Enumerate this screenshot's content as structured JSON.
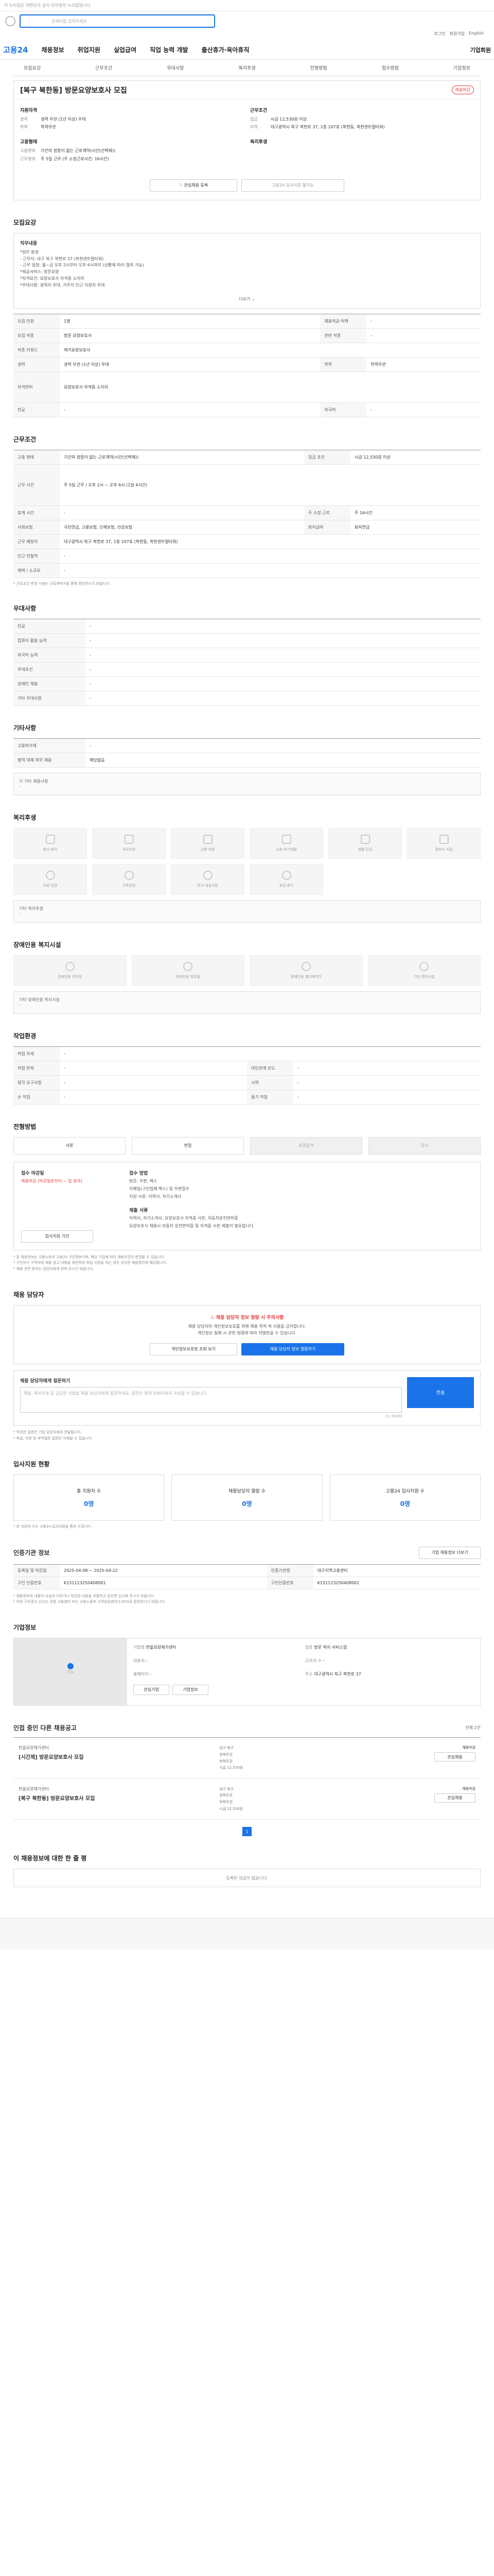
{
  "topbar": {
    "notice": "이 누리집은 대한민국 공식 전자정부 누리집입니다."
  },
  "search": {
    "placeholder": "검색어를 입력하세요"
  },
  "util": [
    "로그인",
    "회원가입",
    "English"
  ],
  "gnb": {
    "brand": "고용24",
    "items": [
      "채용정보",
      "취업지원",
      "실업급여",
      "직업 능력 개발",
      "출산휴가·육아휴직"
    ],
    "right": "기업회원"
  },
  "subtabs": [
    "모집요강",
    "근무조건",
    "우대사항",
    "복리후생",
    "전형방법",
    "접수방법",
    "기업정보"
  ],
  "job": {
    "title": "[복구 북한동] 방문요양보호사 모집",
    "status": "채용마감",
    "left_heading": "지원자격",
    "left": [
      {
        "k": "경력",
        "v": "경력 무관 (1년 이상) 우대"
      },
      {
        "k": "학력",
        "v": "학력무관"
      }
    ],
    "left2_heading": "고용형태",
    "left2": [
      {
        "k": "고용형태",
        "v": "기간의 정함이 없는 근로계약(시간(선택제))"
      },
      {
        "k": "근무형태",
        "v": "주 5일 근무 (주 소정근로시간: 16시간)"
      }
    ],
    "right_heading": "근무조건",
    "right": [
      {
        "k": "임금",
        "v": "시급 12,530원 이상"
      },
      {
        "k": "지역",
        "v": "대구광역시 북구 복현로 37, 1층 107호 (복현동, 복현센트럴타워)"
      }
    ],
    "right2_heading": "복리후생",
    "buttons": [
      "관심채용 등록",
      "고용24 입사지원 불가능"
    ]
  },
  "summary": {
    "heading": "모집요강",
    "label": "직무내용",
    "lines": [
      "*업무 환경",
      "- 근무지: 대구 북구 복현로 37 (복현센트럴타워)",
      "- 근무 일정: 월~금 오후 2시부터 오후 6시까지 (상황에 따라 협의 가능)",
      "*제공서비스: 방문요양",
      "*자격요건: 요양보호사 자격증 소지자",
      "*우대사항: 경력자 우대, 거주지 인근 지원자 우대"
    ],
    "more": "더보기"
  },
  "recruit_rows": [
    {
      "k1": "모집 인원",
      "v1": "1명",
      "k2": "채용직급·직책",
      "v2": "-"
    },
    {
      "k1": "모집 직종",
      "v1": "방문 요양보호사",
      "k2": "관련 직종",
      "v2": "-"
    },
    {
      "k1": "직종 키워드",
      "v1": "재가요양보호사",
      "k2": "",
      "v2": ""
    },
    {
      "k1": "경력",
      "v1": "경력 무관 (1년 이상) 우대",
      "k2": "학력",
      "v2": "학력무관"
    },
    {
      "k1": "자격면허",
      "v1": "요양보호사 자격증 소지자",
      "k2": "",
      "v2": ""
    },
    {
      "k1": "전공",
      "v1": "-",
      "k2": "외국어",
      "v2": "-"
    }
  ],
  "work": {
    "heading": "근무조건",
    "rows": [
      {
        "k1": "고용 형태",
        "v1": "기간의 정함이 없는 근로계약(시간(선택제))",
        "k2": "임금 조건",
        "v2": "시급 12,530원 이상"
      },
      {
        "k1": "근무 시간",
        "v1": "주 5일 근무 / 오후 2시 ~ 오후 6시 (1일 4시간)",
        "k2": "",
        "v2": ""
      },
      {
        "k1": "휴게 시간",
        "v1": "-",
        "k2": "주 소정 근로",
        "v2": "주 16시간"
      },
      {
        "k1": "사회보험",
        "v1": "국민연금, 고용보험, 산재보험, 건강보험",
        "k2": "퇴직급여",
        "v2": "퇴직연금"
      },
      {
        "k1": "근무 예정지",
        "v1": "대구광역시 북구 복현로 37, 1층 107호 (복현동, 복현센트럴타워)",
        "k2": "",
        "v2": ""
      },
      {
        "k1": "인근 전철역",
        "v1": "-",
        "k2": "",
        "v2": ""
      },
      {
        "k1": "재택 / 소규모",
        "v1": "-",
        "k2": "",
        "v2": ""
      }
    ],
    "note": "* 근로조건 변경 시에는 근로계약서를 통해 확인하시기 바랍니다."
  },
  "prefer": {
    "heading": "우대사항",
    "rows": [
      {
        "k": "전공",
        "v": "-"
      },
      {
        "k": "컴퓨터 활용 능력",
        "v": "-"
      },
      {
        "k": "외국어 능력",
        "v": "-"
      },
      {
        "k": "우대조건",
        "v": "-"
      },
      {
        "k": "장애인 채용",
        "v": "-"
      },
      {
        "k": "기타 우대사항",
        "v": "-"
      }
    ]
  },
  "etc": {
    "heading": "기타사항",
    "rows": [
      {
        "k": "고용허가제",
        "v": "-"
      },
      {
        "k": "병역 대체 복무 채용",
        "v": "해당없음"
      }
    ],
    "extra_label": "기 기타 채용사항",
    "extra_value": "-"
  },
  "welfare": {
    "heading": "복리후생",
    "items": [
      "휴가·휴직",
      "식사지원",
      "교통·차량",
      "교육·자기계발",
      "생활·건강",
      "경조사 지원",
      "의료·건강",
      "가족친화",
      "주거·대출지원",
      "포상·휴가"
    ],
    "etc_label": "기타 복리후생",
    "etc_value": "-"
  },
  "disabled": {
    "heading": "장애인용 복지시설",
    "items": [
      "장애인용 주차장",
      "장애인용 화장실",
      "장애인용 엘리베이터",
      "기타 편의시설"
    ],
    "etc_label": "기타 장애인용 복지시설",
    "etc_value": "-"
  },
  "env": {
    "heading": "작업환경",
    "rows": [
      {
        "k1": "작업 자세",
        "v1": "-",
        "k2": "",
        "v2": ""
      },
      {
        "k1": "작업 반복",
        "v1": "-",
        "k2": "대인관계 빈도",
        "v2": "-"
      },
      {
        "k1": "청각 요구사항",
        "v1": "-",
        "k2": "시력",
        "v2": "-"
      },
      {
        "k1": "손 작업",
        "v1": "-",
        "k2": "들기 작업",
        "v2": "-"
      }
    ]
  },
  "process": {
    "heading": "전형방법",
    "steps": [
      "서류",
      "면접",
      "최종합격",
      "입사"
    ],
    "apply_heading": "접수 마감일",
    "apply_date": "채용마감 (마감일로부터 ~ 일 경과)",
    "method_heading": "접수 방법",
    "method_lines": [
      "방문, 우편, 팩스",
      "이메일(구인업체 팩스) 및 우편접수",
      "지원 서류: 이력서, 자기소개서"
    ],
    "docs_heading": "제출 서류",
    "docs_lines": [
      "이력서, 자기소개서, 요양보호사 자격증 사본, 자동차운전면허증",
      "요양보호사 채용시 자동차 운전면허증 및 자격증 사본 제출이 필요합니다."
    ],
    "apply_button": "입사지원 기간",
    "notices": [
      "* 본 채용정보는 고용노동부 고용24 구인정보이며, 해당 기업에 따라 채용조건이 변경될 수 있습니다.",
      "* 구인자가 구직자의 채용 광고 내용을 위반하여 취업 지원을 하는 경우 부당한 채용절차에 해당됩니다.",
      "* 채용 관련 문의는 담당자에게 연락 주시기 바랍니다."
    ]
  },
  "contact": {
    "heading": "채용 담당자",
    "warn": "채용 담당자 정보 열람 시 주의사항",
    "lines": [
      "채용 담당자의 개인정보보호를 위해 채용 목적 외 사용을 금지합니다.",
      "개인정보 침해 시 관련 법령에 따라 처벌받을 수 있습니다."
    ],
    "buttons": [
      "개인정보보호법 조회 보기",
      "채용 담당자 정보 열람하기"
    ]
  },
  "question": {
    "label": "채용 담당자에게 질문하기",
    "placeholder": "채용, 복리후생 등 궁금한 사항을 채용 담당자에게 질문하세요. 질문은 최대 500자까지 작성할 수 있습니다.",
    "counter": "0 / 500자",
    "send": "전송",
    "notes": [
      "* 작성한 질문은 기업 담당자에게 전달됩니다.",
      "* 욕설, 비방 등 부적절한 질문은 삭제될 수 있습니다."
    ]
  },
  "status": {
    "heading": "입사지원 현황",
    "items": [
      {
        "label": "총 지원자 수",
        "value": "0명"
      },
      {
        "label": "채용담당자 열람 수",
        "value": "0명"
      },
      {
        "label": "고용24 입사지원 수",
        "value": "0명"
      }
    ],
    "note": "* 본 지원자 수는 고용24 입사지원을 통한 수입니다."
  },
  "company": {
    "heading": "인증기관 정보",
    "button": "기업 채용정보 더보기",
    "rows": [
      {
        "k1": "등록일 및 마감일",
        "v1": "2025-04-08 ~ 2025-04-22",
        "k2": "인증기관명",
        "v2": "대구지역고용센터"
      },
      {
        "k1": "구인 인증번호",
        "v1": "K151123250408001",
        "k2": "구인인증번호",
        "v2": "K151123250408001"
      }
    ],
    "notes": [
      "* 채용정보의 내용이 사실과 다르거나 부당한 내용을 포함하고 있으면 신고해 주시기 바랍니다.",
      "* 허위 구인광고 신고는 관할 고용센터 또는 고용노동부 고객상담센터(1350)로 문의하시기 바랍니다."
    ]
  },
  "corp": {
    "heading": "기업정보",
    "map_label": "지도",
    "rows": [
      {
        "k": "기업명",
        "v": "한울요양재가센터"
      },
      {
        "k": "업종",
        "v": "방문 복지 서비스업"
      },
      {
        "k": "대표자",
        "v": "-"
      },
      {
        "k": "근로자 수",
        "v": "-"
      },
      {
        "k": "홈페이지",
        "v": "-"
      },
      {
        "k": "주소",
        "v": "대구광역시 북구 복현로 37"
      }
    ],
    "buttons": [
      "관심기업",
      "기업정보"
    ]
  },
  "others": {
    "heading": "인접 중인 다른 채용공고",
    "count": "전체 2건",
    "jobs": [
      {
        "company": "한울요양재가센터",
        "title": "[시간제] 방문요양보호사 모집",
        "tags": [
          "대구 북구",
          "경력무관",
          "학력무관",
          "시급 12,530원"
        ],
        "deadline": "채용마감",
        "btn": "관심채용"
      },
      {
        "company": "한울요양재가센터",
        "title": "[복구 북한동] 방문요양보호사 모집",
        "tags": [
          "대구 북구",
          "경력무관",
          "학력무관",
          "시급 12,530원"
        ],
        "deadline": "채용마감",
        "btn": "관심채용"
      }
    ],
    "pages": [
      "1"
    ]
  },
  "comment": {
    "heading": "이 채용정보에 대한 한 줄 평",
    "text": "등록된 댓글이 없습니다."
  }
}
